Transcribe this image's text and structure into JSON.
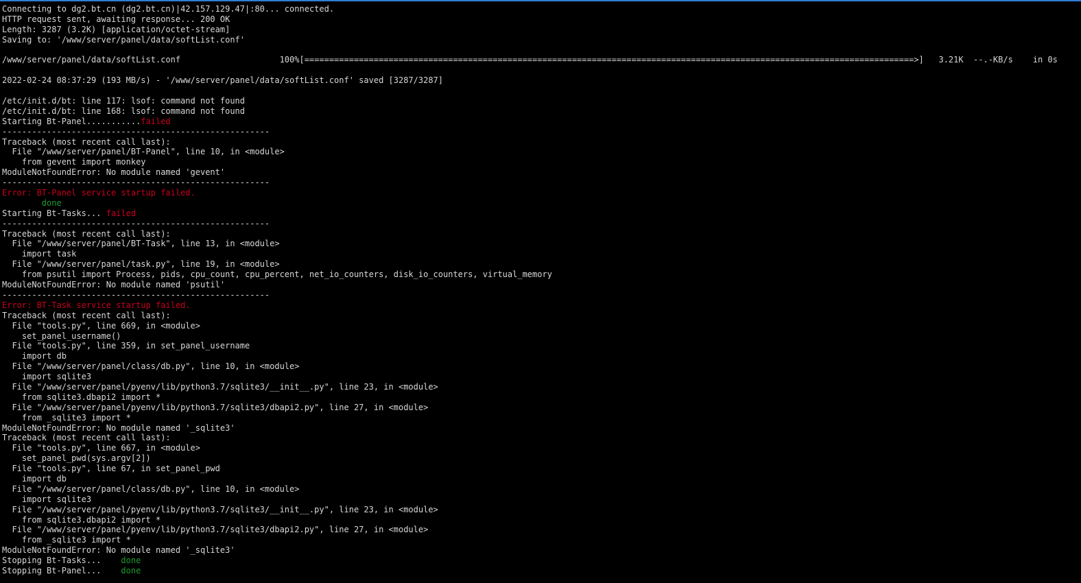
{
  "theme": {
    "background": "#000000",
    "foreground": "#d8d8d8",
    "error": "#c8001e",
    "success": "#1f9d2f",
    "accent_bar": "#2f7fd6"
  },
  "lines": [
    [
      {
        "t": "Connecting to dg2.bt.cn (dg2.bt.cn)|42.157.129.47|:80... connected."
      }
    ],
    [
      {
        "t": "HTTP request sent, awaiting response... 200 OK"
      }
    ],
    [
      {
        "t": "Length: 3287 (3.2K) [application/octet-stream]"
      }
    ],
    [
      {
        "t": "Saving to: '/www/server/panel/data/softList.conf'"
      }
    ],
    [],
    [
      {
        "t": "/www/server/panel/data/softList.conf                    100%[===========================================================================================================================>]   3.21K  --.-KB/s    in 0s"
      }
    ],
    [],
    [
      {
        "t": "2022-02-24 08:37:29 (193 MB/s) - '/www/server/panel/data/softList.conf' saved [3287/3287]"
      }
    ],
    [],
    [
      {
        "t": "/etc/init.d/bt: line 117: lsof: command not found"
      }
    ],
    [
      {
        "t": "/etc/init.d/bt: line 168: lsof: command not found"
      }
    ],
    [
      {
        "t": "Starting Bt-Panel..........."
      },
      {
        "t": "failed",
        "c": "red"
      }
    ],
    [
      {
        "t": "------------------------------------------------------"
      }
    ],
    [
      {
        "t": "Traceback (most recent call last):"
      }
    ],
    [
      {
        "t": "  File \"/www/server/panel/BT-Panel\", line 10, in <module>"
      }
    ],
    [
      {
        "t": "    from gevent import monkey"
      }
    ],
    [
      {
        "t": "ModuleNotFoundError: No module named 'gevent'"
      }
    ],
    [
      {
        "t": "------------------------------------------------------"
      }
    ],
    [
      {
        "t": "Error: BT-Panel service startup failed.",
        "c": "red"
      }
    ],
    [
      {
        "t": "        "
      },
      {
        "t": "done",
        "c": "green"
      }
    ],
    [
      {
        "t": "Starting Bt-Tasks... "
      },
      {
        "t": "failed",
        "c": "red"
      }
    ],
    [
      {
        "t": "------------------------------------------------------"
      }
    ],
    [
      {
        "t": "Traceback (most recent call last):"
      }
    ],
    [
      {
        "t": "  File \"/www/server/panel/BT-Task\", line 13, in <module>"
      }
    ],
    [
      {
        "t": "    import task"
      }
    ],
    [
      {
        "t": "  File \"/www/server/panel/task.py\", line 19, in <module>"
      }
    ],
    [
      {
        "t": "    from psutil import Process, pids, cpu_count, cpu_percent, net_io_counters, disk_io_counters, virtual_memory"
      }
    ],
    [
      {
        "t": "ModuleNotFoundError: No module named 'psutil'"
      }
    ],
    [
      {
        "t": "------------------------------------------------------"
      }
    ],
    [
      {
        "t": "Error: BT-Task service startup failed.",
        "c": "red"
      }
    ],
    [
      {
        "t": "Traceback (most recent call last):"
      }
    ],
    [
      {
        "t": "  File \"tools.py\", line 669, in <module>"
      }
    ],
    [
      {
        "t": "    set_panel_username()"
      }
    ],
    [
      {
        "t": "  File \"tools.py\", line 359, in set_panel_username"
      }
    ],
    [
      {
        "t": "    import db"
      }
    ],
    [
      {
        "t": "  File \"/www/server/panel/class/db.py\", line 10, in <module>"
      }
    ],
    [
      {
        "t": "    import sqlite3"
      }
    ],
    [
      {
        "t": "  File \"/www/server/panel/pyenv/lib/python3.7/sqlite3/__init__.py\", line 23, in <module>"
      }
    ],
    [
      {
        "t": "    from sqlite3.dbapi2 import *"
      }
    ],
    [
      {
        "t": "  File \"/www/server/panel/pyenv/lib/python3.7/sqlite3/dbapi2.py\", line 27, in <module>"
      }
    ],
    [
      {
        "t": "    from _sqlite3 import *"
      }
    ],
    [
      {
        "t": "ModuleNotFoundError: No module named '_sqlite3'"
      }
    ],
    [
      {
        "t": "Traceback (most recent call last):"
      }
    ],
    [
      {
        "t": "  File \"tools.py\", line 667, in <module>"
      }
    ],
    [
      {
        "t": "    set_panel_pwd(sys.argv[2])"
      }
    ],
    [
      {
        "t": "  File \"tools.py\", line 67, in set_panel_pwd"
      }
    ],
    [
      {
        "t": "    import db"
      }
    ],
    [
      {
        "t": "  File \"/www/server/panel/class/db.py\", line 10, in <module>"
      }
    ],
    [
      {
        "t": "    import sqlite3"
      }
    ],
    [
      {
        "t": "  File \"/www/server/panel/pyenv/lib/python3.7/sqlite3/__init__.py\", line 23, in <module>"
      }
    ],
    [
      {
        "t": "    from sqlite3.dbapi2 import *"
      }
    ],
    [
      {
        "t": "  File \"/www/server/panel/pyenv/lib/python3.7/sqlite3/dbapi2.py\", line 27, in <module>"
      }
    ],
    [
      {
        "t": "    from _sqlite3 import *"
      }
    ],
    [
      {
        "t": "ModuleNotFoundError: No module named '_sqlite3'"
      }
    ],
    [
      {
        "t": "Stopping Bt-Tasks...    "
      },
      {
        "t": "done",
        "c": "green"
      }
    ],
    [
      {
        "t": "Stopping Bt-Panel...    "
      },
      {
        "t": "done",
        "c": "green"
      }
    ]
  ]
}
